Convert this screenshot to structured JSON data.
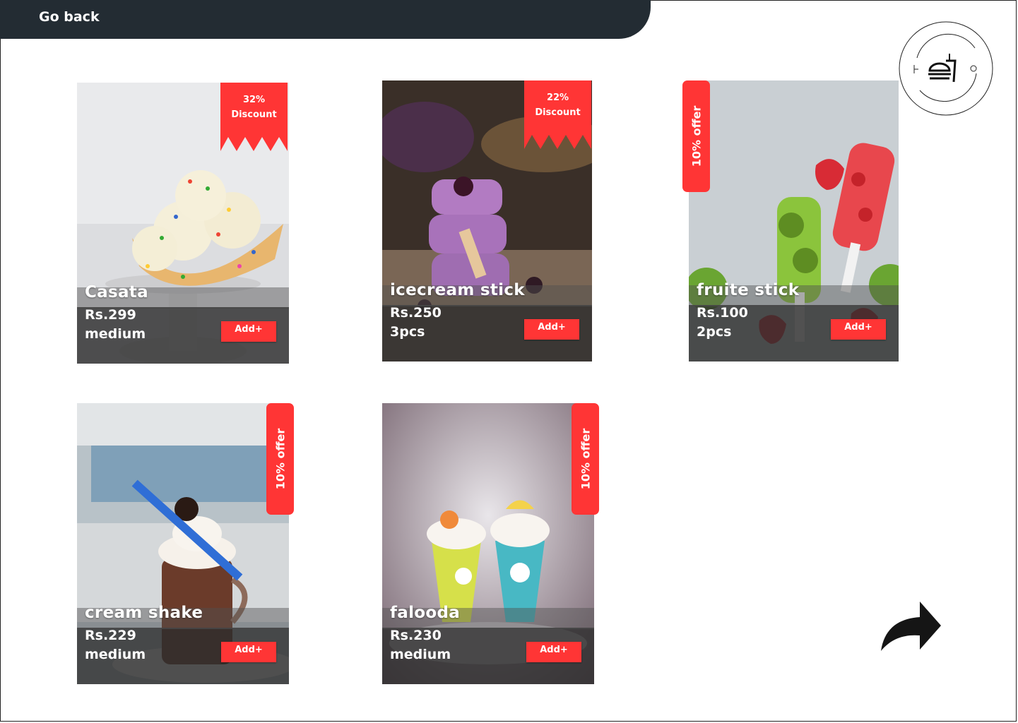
{
  "header": {
    "back_label": "Go back"
  },
  "products": [
    {
      "name": "Casata",
      "price": "Rs.299",
      "size": "medium",
      "add_label": "Add+",
      "badge": {
        "type": "discount",
        "line1": "32%",
        "line2": "Discount"
      }
    },
    {
      "name": "icecream stick",
      "price": "Rs.250",
      "size": "3pcs",
      "add_label": "Add+",
      "badge": {
        "type": "discount",
        "line1": "22%",
        "line2": "Discount"
      }
    },
    {
      "name": "fruite stick",
      "price": "Rs.100",
      "size": "2pcs",
      "add_label": "Add+",
      "badge": {
        "type": "offer",
        "text": "10% offer"
      }
    },
    {
      "name": "cream shake",
      "price": "Rs.229",
      "size": "medium",
      "add_label": "Add+",
      "badge": {
        "type": "offer",
        "text": "10% offer"
      }
    },
    {
      "name": "falooda",
      "price": "Rs.230",
      "size": "medium",
      "add_label": "Add+",
      "badge": {
        "type": "offer",
        "text": "10% offer"
      }
    }
  ],
  "colors": {
    "accent": "#ff3535",
    "header_bg": "#232c33"
  },
  "icons": {
    "logo": "food-tray-logo-icon",
    "next": "forward-arrow-icon"
  }
}
